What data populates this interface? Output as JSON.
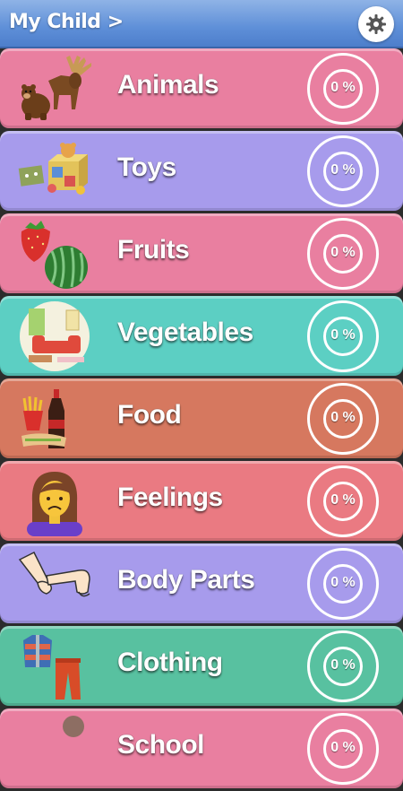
{
  "header": {
    "title": "My Child >",
    "settings_icon": "gear-icon"
  },
  "categories": [
    {
      "label": "Animals",
      "progress": "0 %",
      "color": "#e97fa0",
      "icon": "animals-icon"
    },
    {
      "label": "Toys",
      "progress": "0 %",
      "color": "#a79bec",
      "icon": "toys-icon"
    },
    {
      "label": "Fruits",
      "progress": "0 %",
      "color": "#e97fa0",
      "icon": "fruits-icon"
    },
    {
      "label": "Vegetables",
      "progress": "0 %",
      "color": "#5ccfc3",
      "icon": "vegetables-icon"
    },
    {
      "label": "Food",
      "progress": "0 %",
      "color": "#d6785f",
      "icon": "food-icon"
    },
    {
      "label": "Feelings",
      "progress": "0 %",
      "color": "#ea7a82",
      "icon": "feelings-icon"
    },
    {
      "label": "Body Parts",
      "progress": "0 %",
      "color": "#a79bec",
      "icon": "body-parts-icon"
    },
    {
      "label": "Clothing",
      "progress": "0 %",
      "color": "#58c1a0",
      "icon": "clothing-icon"
    },
    {
      "label": "School",
      "progress": "0 %",
      "color": "#e97fa0",
      "icon": "school-icon"
    }
  ]
}
